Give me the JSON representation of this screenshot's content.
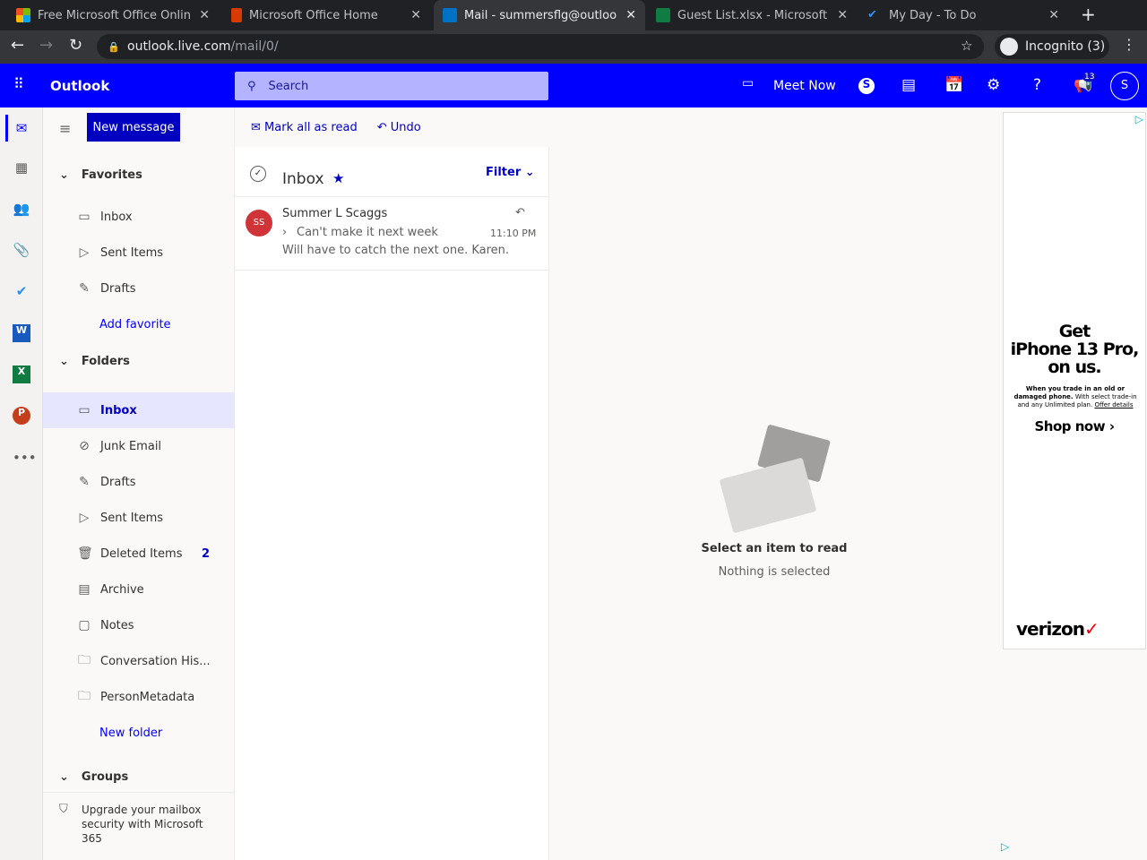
{
  "browser": {
    "tabs": [
      {
        "title": "Free Microsoft Office Onlin",
        "icon": "microsoft-logo-icon"
      },
      {
        "title": "Microsoft Office Home",
        "icon": "office-icon"
      },
      {
        "title": "Mail - summersflg@outloo",
        "icon": "outlook-icon",
        "active": true
      },
      {
        "title": "Guest List.xlsx - Microsoft",
        "icon": "excel-icon"
      },
      {
        "title": "My Day - To Do",
        "icon": "todo-icon"
      }
    ],
    "url_host": "outlook.live.com",
    "url_path": "/mail/0/",
    "incognito": "Incognito (3)"
  },
  "header": {
    "app": "Outlook",
    "search_placeholder": "Search",
    "meet_now": "Meet Now",
    "notification_count": "13",
    "avatar": "S",
    "accent": "#0000ff"
  },
  "commands": {
    "new_message": "New message",
    "mark_all_read": "Mark all as read",
    "undo": "Undo"
  },
  "favorites": {
    "title": "Favorites",
    "items": [
      "Inbox",
      "Sent Items",
      "Drafts"
    ],
    "add": "Add favorite"
  },
  "folders": {
    "title": "Folders",
    "items": [
      {
        "label": "Inbox",
        "icon": "inbox-icon"
      },
      {
        "label": "Junk Email",
        "icon": "junk-icon"
      },
      {
        "label": "Drafts",
        "icon": "pencil-icon"
      },
      {
        "label": "Sent Items",
        "icon": "send-icon"
      },
      {
        "label": "Deleted Items",
        "icon": "trash-icon",
        "count": "2"
      },
      {
        "label": "Archive",
        "icon": "archive-icon"
      },
      {
        "label": "Notes",
        "icon": "note-icon"
      },
      {
        "label": "Conversation His...",
        "icon": "folder-icon"
      },
      {
        "label": "PersonMetadata",
        "icon": "folder-icon"
      }
    ],
    "new_folder": "New folder"
  },
  "groups": {
    "title": "Groups"
  },
  "upgrade": "Upgrade your mailbox security with Microsoft 365",
  "list": {
    "title": "Inbox",
    "filter": "Filter",
    "messages": [
      {
        "initials": "SS",
        "sender": "Summer L Scaggs",
        "subject": "Can't make it next week",
        "time": "11:10 PM",
        "preview": "Will have to catch the next one. Karen."
      }
    ]
  },
  "reading": {
    "title": "Select an item to read",
    "subtitle": "Nothing is selected"
  },
  "ad": {
    "headline1": "Get",
    "headline2": "iPhone 13 Pro,",
    "headline3": "on us.",
    "fine_bold": "When you trade in an old or damaged phone.",
    "fine": "With select trade-in and any Unlimited plan.",
    "offer": "Offer details",
    "cta": "Shop now",
    "brand": "verizon"
  }
}
